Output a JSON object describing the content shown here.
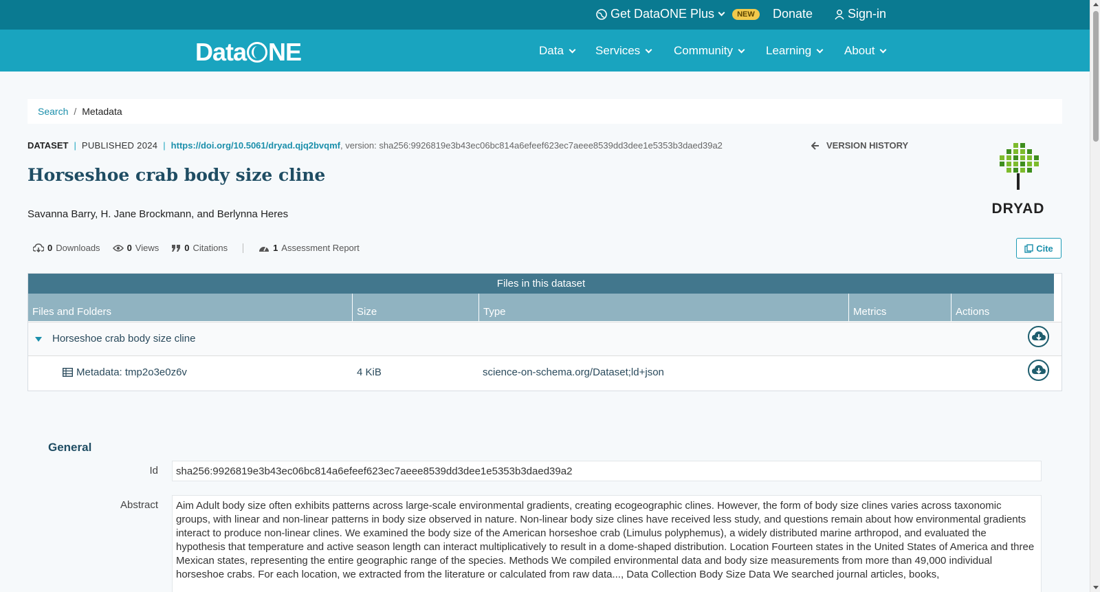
{
  "topbar": {
    "plus_label": "Get DataONE Plus",
    "new_badge": "NEW",
    "donate_label": "Donate",
    "signin_label": "Sign-in"
  },
  "navbar": {
    "logo_text_left": "Data",
    "logo_text_right": "NE",
    "items": [
      "Data",
      "Services",
      "Community",
      "Learning",
      "About"
    ]
  },
  "breadcrumb": {
    "search": "Search",
    "sep": "/",
    "current": "Metadata"
  },
  "dataset": {
    "type": "DATASET",
    "published": "PUBLISHED 2024",
    "doi": "https://doi.org/10.5061/dryad.qjq2bvqmf",
    "version": ", version: sha256:9926819e3b43ec06bc814a6efeef623ec7aeee8539dd3dee1e5353b3daed39a2",
    "version_history": "VERSION HISTORY",
    "title": "Horseshoe crab body size cline",
    "authors": "Savanna Barry, H. Jane Brockmann, and Berlynna Heres",
    "repository_logo_text": "DRYAD"
  },
  "metrics": {
    "downloads_count": "0",
    "downloads_label": "Downloads",
    "views_count": "0",
    "views_label": "Views",
    "citations_count": "0",
    "citations_label": "Citations",
    "assessment_count": "1",
    "assessment_label": "Assessment Report"
  },
  "cite_label": "Cite",
  "files_table": {
    "caption": "Files in this dataset",
    "columns": [
      "Files and Folders",
      "Size",
      "Type",
      "Metrics",
      "Actions"
    ],
    "folder": {
      "name": "Horseshoe crab body size cline"
    },
    "file": {
      "name": "Metadata: tmp2o3e0z6v",
      "size": "4 KiB",
      "type": "science-on-schema.org/Dataset;ld+json"
    }
  },
  "general": {
    "heading": "General",
    "id_label": "Id",
    "id_value": "sha256:9926819e3b43ec06bc814a6efeef623ec7aeee8539dd3dee1e5353b3daed39a2",
    "abstract_label": "Abstract",
    "abstract_value": "Aim Adult body size often exhibits patterns across large-scale environmental gradients, creating ecogeographic clines. However, the form of body size clines varies across taxonomic groups, with linear and non-linear patterns in body size observed in nature. Non-linear body size clines have received less study, and questions remain about how environmental gradients interact to produce non-linear clines. We examined the body size of the American horseshoe crab (Limulus polyphemus), a widely distributed marine arthropod, and evaluated the hypothesis that temperature and active season length can interact multiplicatively to result in a dome-shaped distribution. Location Fourteen states in the United States of America and three Mexican states, representing the entire geographic range of the species. Methods We compiled environmental data and body size measurements from more than 49,000 individual horseshoe crabs. For each location, we extracted from the literature or calculated from raw data..., Data Collection Body Size Data We searched journal articles, books,"
  },
  "colors": {
    "topbar": "#0a7a91",
    "navbar": "#19a4bf",
    "accent": "#1b8fab",
    "title": "#1f4d63"
  }
}
